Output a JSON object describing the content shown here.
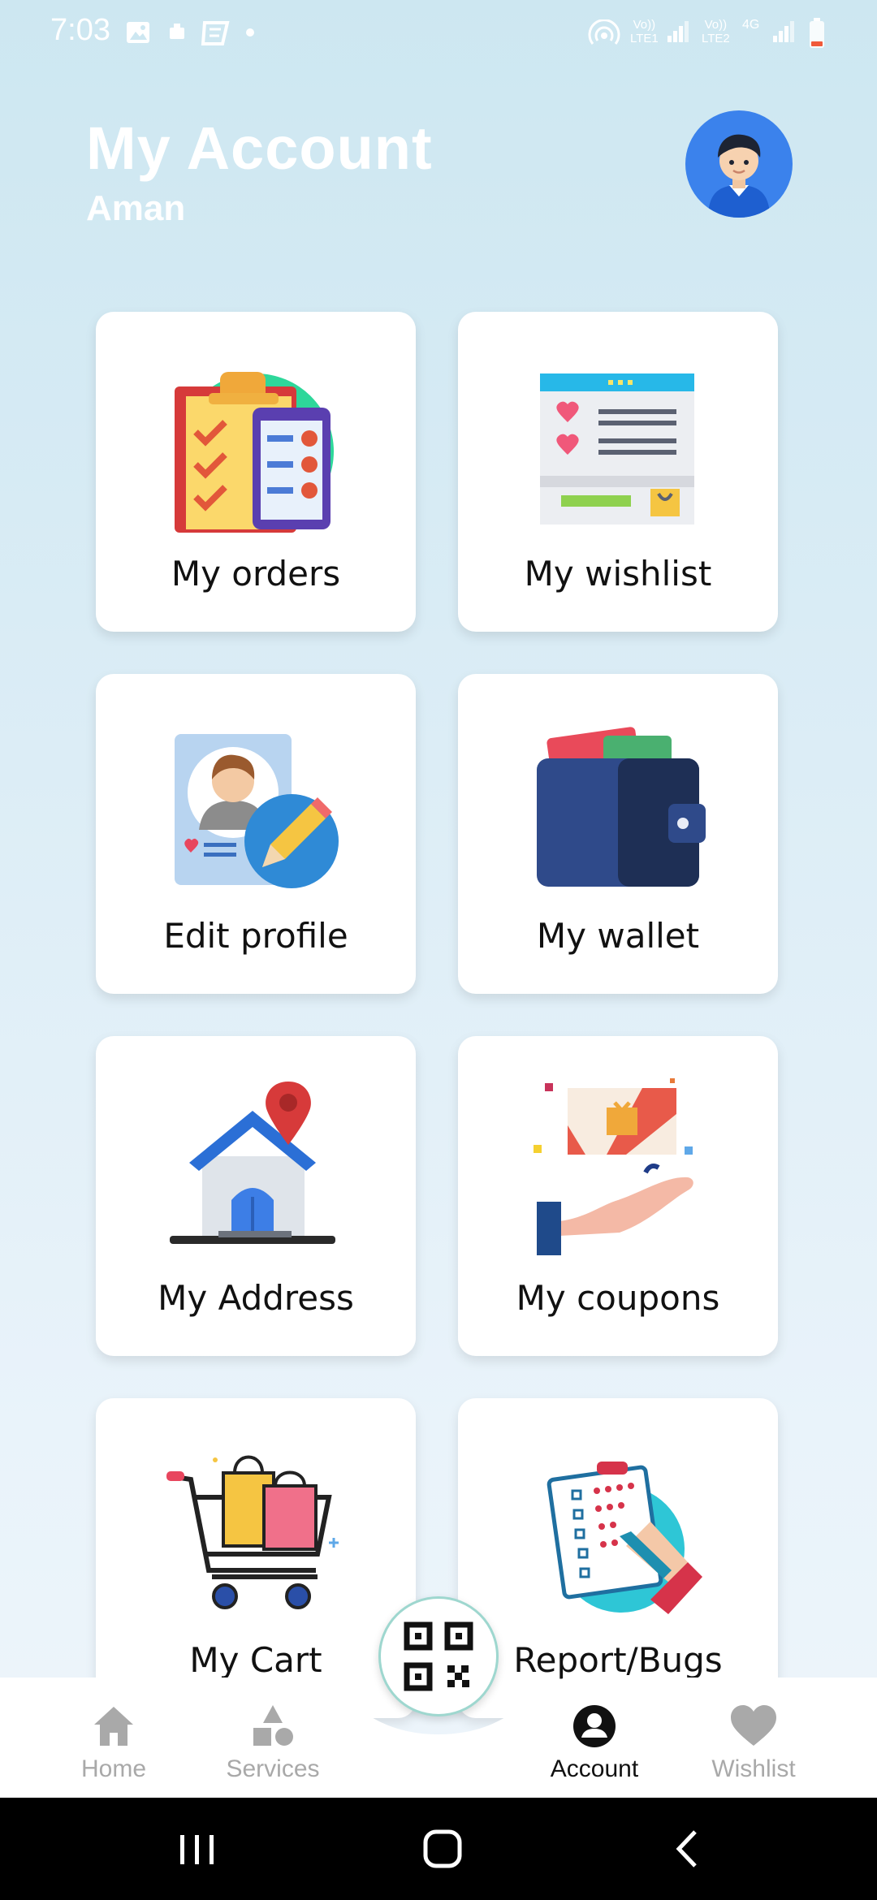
{
  "status_bar": {
    "time": "7:03",
    "sim1_label_top": "Vo))",
    "sim1_label_bottom": "LTE1",
    "sim2_label_top": "Vo))",
    "sim2_label_bottom": "LTE2",
    "network_type": "4G"
  },
  "header": {
    "title": "My Account",
    "user_name": "Aman"
  },
  "cards": [
    {
      "label": "My orders",
      "icon": "orders-clipboard-icon"
    },
    {
      "label": "My wishlist",
      "icon": "wishlist-page-icon"
    },
    {
      "label": "Edit profile",
      "icon": "edit-profile-icon"
    },
    {
      "label": "My wallet",
      "icon": "wallet-icon"
    },
    {
      "label": "My Address",
      "icon": "house-location-icon"
    },
    {
      "label": "My coupons",
      "icon": "coupon-gift-icon"
    },
    {
      "label": "My Cart",
      "icon": "shopping-cart-icon"
    },
    {
      "label": "Report/Bugs",
      "icon": "report-checklist-icon"
    }
  ],
  "bottom_nav": [
    {
      "label": "Home",
      "icon": "home-icon",
      "active": false
    },
    {
      "label": "Services",
      "icon": "services-shapes-icon",
      "active": false
    },
    {
      "label": "Account",
      "icon": "account-person-icon",
      "active": true
    },
    {
      "label": "Wishlist",
      "icon": "heart-icon",
      "active": false
    }
  ],
  "qr_button": {
    "icon": "qr-code-icon"
  },
  "colors": {
    "background_top": "#cde7f1",
    "background_bottom": "#eef5fb",
    "card": "#ffffff",
    "avatar": "#3b82ec",
    "nav_inactive": "#a9a9a9",
    "nav_active": "#111111"
  }
}
